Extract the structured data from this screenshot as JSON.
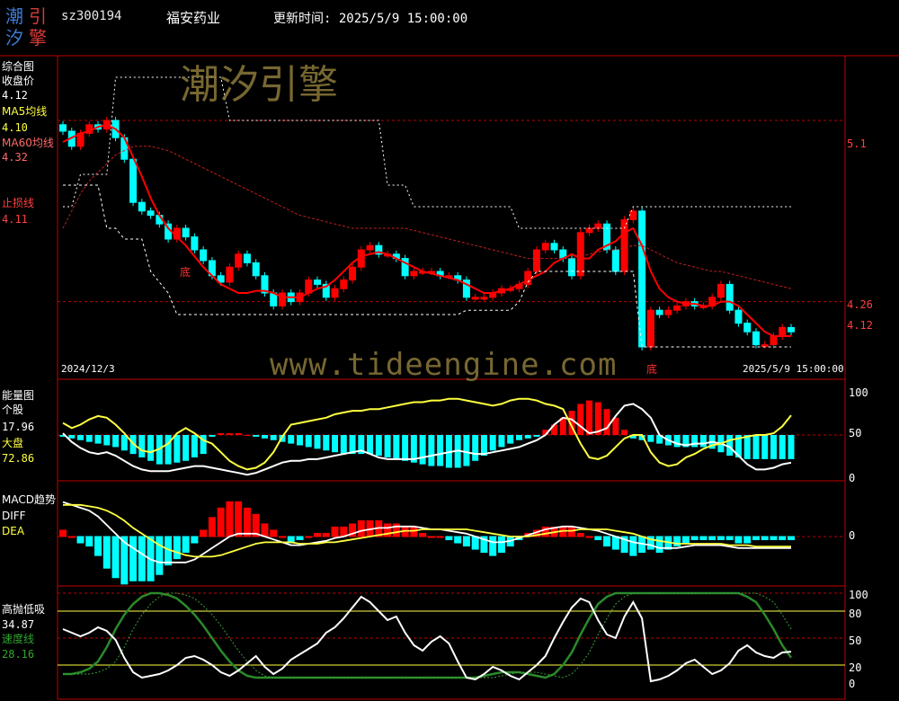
{
  "header": {
    "logo_chars": [
      "潮",
      "引",
      "汐",
      "擎"
    ],
    "code": "sz300194",
    "name": "福安药业",
    "time_label": "更新时间: 2025/5/9 15:00:00"
  },
  "watermark": {
    "text": "潮汐引擎",
    "url": "www.tideengine.com"
  },
  "panel1": {
    "title": "综合图",
    "close_label": "收盘价",
    "close_value": "4.12",
    "ma5_label": "MA5均线",
    "ma5_value": "4.10",
    "ma60_label": "MA60均线",
    "ma60_value": "4.32",
    "stop_label": "止损线",
    "stop_value": "4.11",
    "start_date": "2024/12/3",
    "end_date": "2025/5/9 15:00:00",
    "price_levels": [
      "5.1",
      "4.26",
      "4.12"
    ],
    "bottom_marks": [
      "底",
      "底"
    ]
  },
  "panel2": {
    "title": "能量图",
    "stock_label": "个股",
    "stock_value": "17.96",
    "market_label": "大盘",
    "market_value": "72.86",
    "ticks": [
      "100",
      "50",
      "0"
    ]
  },
  "panel3": {
    "title": "MACD趋势",
    "diff_label": "DIFF",
    "dea_label": "DEA",
    "ticks": [
      "0"
    ]
  },
  "panel4": {
    "title": "高抛低吸",
    "value": "34.87",
    "speed_label": "速度线",
    "speed_value": "28.16",
    "ticks": [
      "100",
      "80",
      "50",
      "20",
      "0"
    ]
  },
  "colors": {
    "up": "#ff0000",
    "down": "#00ffff",
    "ma5": "#ff0000",
    "yellow": "#ffff40",
    "green": "#2a8a2a",
    "frame": "#c00000"
  },
  "chart_data": [
    {
      "type": "candlestick",
      "title": "综合图",
      "x_range": [
        "2024/12/3",
        "2025/5/9"
      ],
      "ylim": [
        3.9,
        5.4
      ],
      "series": [
        {
          "name": "收盘价",
          "values": [
            5.05,
            4.98,
            5.04,
            5.08,
            5.06,
            5.1,
            5.02,
            4.92,
            4.72,
            4.68,
            4.66,
            4.62,
            4.55,
            4.6,
            4.56,
            4.5,
            4.45,
            4.38,
            4.35,
            4.42,
            4.48,
            4.44,
            4.38,
            4.3,
            4.24,
            4.3,
            4.26,
            4.3,
            4.36,
            4.34,
            4.28,
            4.32,
            4.36,
            4.42,
            4.5,
            4.52,
            4.48,
            4.48,
            4.46,
            4.38,
            4.4,
            4.4,
            4.4,
            4.38,
            4.38,
            4.36,
            4.28,
            4.28,
            4.28,
            4.3,
            4.32,
            4.32,
            4.34,
            4.4,
            4.5,
            4.53,
            4.5,
            4.46,
            4.38,
            4.58,
            4.6,
            4.62,
            4.5,
            4.4,
            4.64,
            4.68,
            4.05,
            4.22,
            4.2,
            4.22,
            4.24,
            4.26,
            4.24,
            4.24,
            4.28,
            4.34,
            4.22,
            4.16,
            4.12,
            4.06,
            4.06,
            4.1,
            4.14,
            4.12
          ]
        },
        {
          "name": "MA5均线",
          "values": [
            5.0,
            5.02,
            5.04,
            5.05,
            5.07,
            5.08,
            5.06,
            5.02,
            4.93,
            4.84,
            4.74,
            4.66,
            4.6,
            4.56,
            4.52,
            4.47,
            4.42,
            4.38,
            4.34,
            4.32,
            4.3,
            4.3,
            4.31,
            4.31,
            4.3,
            4.28,
            4.28,
            4.28,
            4.3,
            4.32,
            4.33,
            4.36,
            4.4,
            4.44,
            4.47,
            4.48,
            4.49,
            4.48,
            4.46,
            4.44,
            4.42,
            4.4,
            4.39,
            4.38,
            4.37,
            4.36,
            4.34,
            4.32,
            4.3,
            4.3,
            4.31,
            4.32,
            4.34,
            4.36,
            4.38,
            4.4,
            4.44,
            4.46,
            4.48,
            4.46,
            4.46,
            4.5,
            4.52,
            4.54,
            4.58,
            4.6,
            4.52,
            4.4,
            4.32,
            4.28,
            4.26,
            4.25,
            4.25,
            4.24,
            4.24,
            4.26,
            4.26,
            4.24,
            4.2,
            4.16,
            4.12,
            4.1,
            4.1,
            4.1
          ]
        },
        {
          "name": "MA60均线",
          "values": [
            4.6,
            4.68,
            4.76,
            4.82,
            4.86,
            4.9,
            4.94,
            4.96,
            4.98,
            4.98,
            4.98,
            4.97,
            4.96,
            4.94,
            4.92,
            4.9,
            4.88,
            4.86,
            4.84,
            4.82,
            4.8,
            4.78,
            4.76,
            4.74,
            4.72,
            4.7,
            4.68,
            4.66,
            4.65,
            4.64,
            4.63,
            4.62,
            4.61,
            4.6,
            4.6,
            4.6,
            4.6,
            4.6,
            4.6,
            4.6,
            4.59,
            4.58,
            4.57,
            4.56,
            4.55,
            4.54,
            4.53,
            4.52,
            4.51,
            4.5,
            4.49,
            4.48,
            4.47,
            4.46,
            4.46,
            4.46,
            4.46,
            4.46,
            4.46,
            4.47,
            4.48,
            4.49,
            4.5,
            4.5,
            4.51,
            4.52,
            4.52,
            4.5,
            4.48,
            4.46,
            4.44,
            4.43,
            4.42,
            4.41,
            4.4,
            4.4,
            4.39,
            4.38,
            4.37,
            4.36,
            4.35,
            4.34,
            4.33,
            4.32
          ]
        }
      ]
    },
    {
      "type": "line",
      "title": "能量图",
      "ylim": [
        0,
        100
      ],
      "series": [
        {
          "name": "个股",
          "values": [
            52,
            42,
            35,
            30,
            28,
            30,
            26,
            20,
            14,
            10,
            8,
            8,
            8,
            10,
            12,
            14,
            14,
            12,
            10,
            8,
            6,
            4,
            6,
            10,
            14,
            18,
            20,
            20,
            22,
            22,
            24,
            26,
            28,
            30,
            32,
            28,
            24,
            22,
            22,
            22,
            22,
            24,
            26,
            28,
            30,
            32,
            30,
            28,
            28,
            30,
            32,
            34,
            36,
            40,
            44,
            50,
            62,
            70,
            68,
            60,
            52,
            54,
            58,
            72,
            84,
            86,
            80,
            70,
            50,
            44,
            40,
            38,
            40,
            40,
            42,
            40,
            36,
            26,
            16,
            10,
            10,
            12,
            16,
            17.96
          ]
        },
        {
          "name": "大盘",
          "values": [
            64,
            58,
            62,
            68,
            72,
            70,
            62,
            52,
            40,
            32,
            30,
            34,
            40,
            52,
            58,
            52,
            44,
            40,
            30,
            20,
            14,
            10,
            12,
            18,
            30,
            48,
            62,
            64,
            66,
            68,
            70,
            74,
            76,
            78,
            78,
            80,
            80,
            82,
            84,
            86,
            88,
            88,
            90,
            90,
            92,
            92,
            90,
            88,
            86,
            84,
            86,
            90,
            92,
            92,
            90,
            86,
            84,
            80,
            60,
            40,
            24,
            22,
            26,
            36,
            46,
            50,
            50,
            30,
            18,
            14,
            16,
            24,
            28,
            34,
            38,
            40,
            44,
            46,
            48,
            50,
            50,
            52,
            60,
            72.86
          ]
        },
        {
          "name": "柱",
          "values": [
            -2,
            -4,
            -6,
            -8,
            -10,
            -12,
            -14,
            -18,
            -22,
            -26,
            -30,
            -34,
            -34,
            -32,
            -30,
            -26,
            -22,
            -2,
            2,
            2,
            2,
            0,
            -2,
            -4,
            -6,
            -8,
            -10,
            -12,
            -14,
            -16,
            -18,
            -20,
            -22,
            -22,
            -22,
            -22,
            -24,
            -26,
            -28,
            -30,
            -32,
            -34,
            -36,
            -36,
            -38,
            -38,
            -36,
            -30,
            -24,
            -18,
            -14,
            -10,
            -6,
            -4,
            -2,
            6,
            12,
            20,
            28,
            36,
            40,
            38,
            30,
            20,
            6,
            -4,
            -6,
            -8,
            -10,
            -12,
            -14,
            -14,
            -14,
            -14,
            -16,
            -20,
            -24,
            -26,
            -28,
            -28,
            -28,
            -28,
            -28,
            -28
          ]
        }
      ]
    },
    {
      "type": "bar",
      "title": "MACD趋势",
      "ylim": [
        -0.3,
        0.3
      ],
      "series": [
        {
          "name": "DIFF",
          "values": [
            0.24,
            0.22,
            0.2,
            0.18,
            0.14,
            0.08,
            0.02,
            -0.04,
            -0.08,
            -0.12,
            -0.16,
            -0.18,
            -0.18,
            -0.18,
            -0.18,
            -0.16,
            -0.12,
            -0.08,
            -0.04,
            0,
            0.02,
            0.02,
            0.02,
            0.0,
            -0.02,
            -0.04,
            -0.06,
            -0.06,
            -0.05,
            -0.04,
            -0.03,
            -0.01,
            0.0,
            0.02,
            0.04,
            0.05,
            0.06,
            0.06,
            0.07,
            0.07,
            0.07,
            0.06,
            0.05,
            0.05,
            0.04,
            0.03,
            0.02,
            0.0,
            -0.02,
            -0.04,
            -0.04,
            -0.03,
            -0.01,
            0.01,
            0.03,
            0.05,
            0.06,
            0.07,
            0.07,
            0.06,
            0.05,
            0.04,
            0.02,
            0.0,
            -0.02,
            -0.04,
            -0.05,
            -0.06,
            -0.08,
            -0.08,
            -0.08,
            -0.07,
            -0.06,
            -0.06,
            -0.06,
            -0.06,
            -0.07,
            -0.08,
            -0.08,
            -0.08,
            -0.08,
            -0.08,
            -0.08,
            -0.08
          ]
        },
        {
          "name": "DEA",
          "values": [
            0.22,
            0.22,
            0.22,
            0.21,
            0.2,
            0.18,
            0.15,
            0.11,
            0.06,
            0.02,
            -0.02,
            -0.06,
            -0.09,
            -0.11,
            -0.13,
            -0.14,
            -0.14,
            -0.14,
            -0.13,
            -0.11,
            -0.09,
            -0.07,
            -0.05,
            -0.04,
            -0.04,
            -0.04,
            -0.04,
            -0.05,
            -0.05,
            -0.05,
            -0.04,
            -0.04,
            -0.03,
            -0.02,
            -0.01,
            0.0,
            0.01,
            0.02,
            0.03,
            0.04,
            0.04,
            0.05,
            0.05,
            0.05,
            0.05,
            0.05,
            0.05,
            0.04,
            0.03,
            0.02,
            0.01,
            0.0,
            0.0,
            0.0,
            0.01,
            0.02,
            0.03,
            0.04,
            0.04,
            0.05,
            0.05,
            0.05,
            0.05,
            0.04,
            0.03,
            0.02,
            0.0,
            -0.02,
            -0.03,
            -0.04,
            -0.05,
            -0.05,
            -0.05,
            -0.05,
            -0.05,
            -0.05,
            -0.06,
            -0.06,
            -0.06,
            -0.07,
            -0.07,
            -0.07,
            -0.07,
            -0.07
          ]
        },
        {
          "name": "MACD",
          "values": [
            0.02,
            0,
            -0.02,
            -0.03,
            -0.06,
            -0.1,
            -0.13,
            -0.15,
            -0.14,
            -0.14,
            -0.14,
            -0.12,
            -0.09,
            -0.07,
            -0.05,
            -0.02,
            0.02,
            0.06,
            0.09,
            0.11,
            0.11,
            0.09,
            0.07,
            0.04,
            0.02,
            0.0,
            -0.02,
            -0.01,
            0.0,
            0.01,
            0.01,
            0.03,
            0.03,
            0.04,
            0.05,
            0.05,
            0.05,
            0.04,
            0.04,
            0.03,
            0.03,
            0.01,
            0.0,
            0.0,
            -0.01,
            -0.02,
            -0.03,
            -0.04,
            -0.05,
            -0.06,
            -0.05,
            -0.03,
            -0.01,
            0.01,
            0.02,
            0.03,
            0.03,
            0.03,
            0.03,
            0.01,
            0.0,
            -0.01,
            -0.03,
            -0.04,
            -0.05,
            -0.06,
            -0.05,
            -0.04,
            -0.05,
            -0.04,
            -0.03,
            -0.02,
            -0.01,
            -0.01,
            -0.01,
            -0.01,
            -0.01,
            -0.02,
            -0.02,
            -0.01,
            -0.01,
            -0.01,
            -0.01,
            -0.01
          ]
        }
      ]
    },
    {
      "type": "line",
      "title": "高抛低吸",
      "ylim": [
        0,
        100
      ],
      "series": [
        {
          "name": "高抛低吸",
          "values": [
            60,
            56,
            52,
            56,
            62,
            58,
            48,
            28,
            12,
            6,
            8,
            10,
            14,
            20,
            28,
            30,
            26,
            20,
            12,
            8,
            14,
            22,
            30,
            18,
            10,
            16,
            26,
            32,
            38,
            44,
            56,
            62,
            72,
            84,
            96,
            90,
            80,
            70,
            74,
            56,
            42,
            36,
            46,
            52,
            44,
            24,
            6,
            4,
            10,
            18,
            14,
            8,
            4,
            12,
            20,
            30,
            50,
            68,
            84,
            94,
            90,
            70,
            54,
            50,
            74,
            90,
            72,
            2,
            4,
            8,
            14,
            22,
            26,
            18,
            10,
            14,
            22,
            36,
            42,
            34,
            30,
            28,
            34,
            34.87
          ]
        },
        {
          "name": "速度线",
          "values": [
            10,
            10,
            12,
            16,
            24,
            40,
            60,
            76,
            88,
            96,
            100,
            100,
            98,
            94,
            86,
            76,
            64,
            50,
            36,
            24,
            14,
            8,
            6,
            6,
            6,
            6,
            6,
            6,
            6,
            6,
            6,
            6,
            6,
            6,
            6,
            6,
            6,
            6,
            6,
            6,
            6,
            6,
            6,
            6,
            6,
            6,
            6,
            6,
            8,
            10,
            12,
            12,
            12,
            10,
            8,
            6,
            10,
            20,
            34,
            54,
            72,
            88,
            96,
            100,
            100,
            100,
            100,
            100,
            100,
            100,
            100,
            100,
            100,
            100,
            100,
            100,
            100,
            100,
            96,
            90,
            76,
            60,
            42,
            28.16
          ]
        }
      ]
    }
  ]
}
